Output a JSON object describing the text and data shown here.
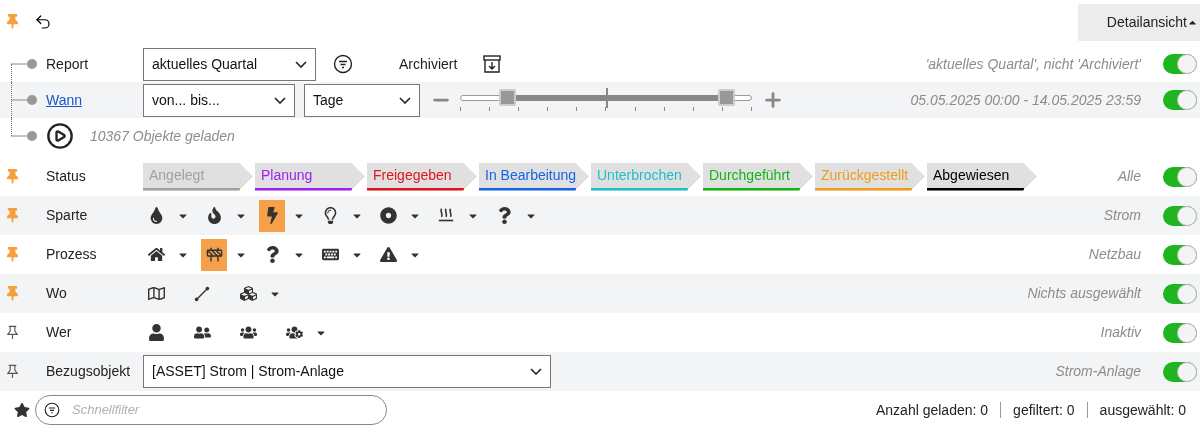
{
  "toolbar": {
    "pinned": true,
    "view_button": "Detailansicht",
    "view_expanded": true
  },
  "header_filters": [
    {
      "kind": "report",
      "label": "Report",
      "select": "aktuelles Quartal",
      "archived_label": "Archiviert",
      "summary": "'aktuelles Quartal', nicht 'Archiviert'",
      "on": true
    },
    {
      "kind": "when",
      "label": "Wann",
      "select": "von... bis...",
      "unit": "Tage",
      "thumbs": [
        {
          "level": 0.17
        },
        {
          "level": 0.9
        }
      ],
      "summary": "05.05.2025 00:00 - 14.05.2025 23:59",
      "on": true
    },
    {
      "kind": "load",
      "status": "10367 Objekte geladen"
    }
  ],
  "filters": [
    {
      "kind": "status",
      "pinned": true,
      "label": "Status",
      "stages": [
        {
          "label": "Angelegt",
          "color": "#a0a0a0"
        },
        {
          "label": "Planung",
          "color": "#a020f0"
        },
        {
          "label": "Freigegeben",
          "color": "#e0141e"
        },
        {
          "label": "In Bearbeitung",
          "color": "#1464e6"
        },
        {
          "label": "Unterbrochen",
          "color": "#1ebecc"
        },
        {
          "label": "Durchgeführt",
          "color": "#14b414"
        },
        {
          "label": "Zurückgestellt",
          "color": "#f09a1e"
        },
        {
          "label": "Abgewiesen",
          "color": "#000000"
        }
      ],
      "summary": "Alle",
      "on": true
    },
    {
      "kind": "icons",
      "pinned": true,
      "label": "Sparte",
      "items": [
        {
          "selected": false,
          "dropdown": true
        },
        {
          "selected": false,
          "dropdown": true
        },
        {
          "selected": true,
          "dropdown": true
        },
        {
          "selected": false,
          "dropdown": true
        },
        {
          "selected": false,
          "dropdown": true
        },
        {
          "selected": false,
          "dropdown": true
        },
        {
          "selected": false,
          "dropdown": true
        }
      ],
      "summary": "Strom",
      "on": true
    },
    {
      "kind": "icons",
      "pinned": true,
      "label": "Prozess",
      "items": [
        {
          "selected": false,
          "dropdown": true
        },
        {
          "selected": true,
          "dropdown": true
        },
        {
          "selected": false,
          "dropdown": true
        },
        {
          "selected": false,
          "dropdown": true
        },
        {
          "selected": false,
          "dropdown": true
        }
      ],
      "summary": "Netzbau",
      "on": true
    },
    {
      "kind": "icons",
      "pinned": true,
      "label": "Wo",
      "items": [
        {
          "selected": false,
          "dropdown": false
        },
        {
          "selected": false,
          "dropdown": false
        },
        {
          "selected": false,
          "dropdown": true
        }
      ],
      "summary": "Nichts ausgewählt",
      "on": true
    },
    {
      "kind": "icons",
      "pinned": false,
      "label": "Wer",
      "items": [
        {
          "selected": false,
          "dropdown": false
        },
        {
          "selected": false,
          "dropdown": false
        },
        {
          "selected": false,
          "dropdown": false
        },
        {
          "selected": false,
          "dropdown": true
        }
      ],
      "summary": "Inaktiv",
      "on": true
    },
    {
      "kind": "select",
      "pinned": false,
      "label": "Bezugsobjekt",
      "select": "[ASSET] Strom | Strom-Anlage",
      "summary": "Strom-Anlage",
      "on": true
    }
  ],
  "quick_filter": {
    "placeholder": "Schnellfilter"
  },
  "counts": [
    {
      "label": "Anzahl geladen:",
      "value": "0"
    },
    {
      "label": "gefiltert:",
      "value": "0"
    },
    {
      "label": "ausgewählt:",
      "value": "0"
    }
  ]
}
